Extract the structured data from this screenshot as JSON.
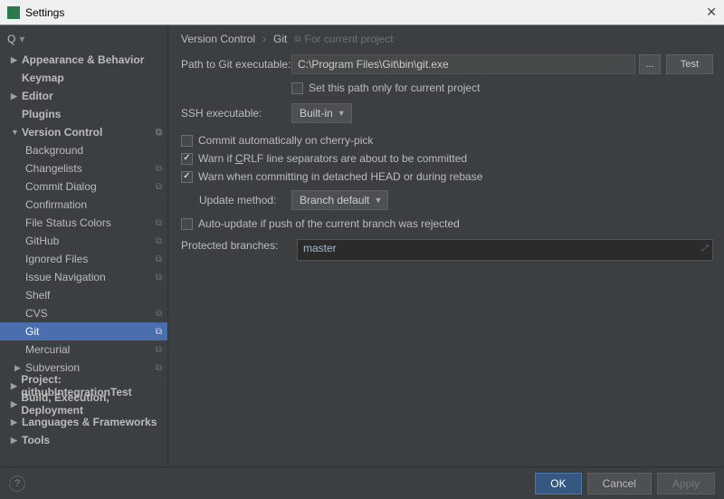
{
  "window": {
    "title": "Settings"
  },
  "search": {
    "placeholder": ""
  },
  "tree": {
    "appearance": "Appearance & Behavior",
    "keymap": "Keymap",
    "editor": "Editor",
    "plugins": "Plugins",
    "versionControl": "Version Control",
    "background": "Background",
    "changelists": "Changelists",
    "commitDialog": "Commit Dialog",
    "confirmation": "Confirmation",
    "fileStatusColors": "File Status Colors",
    "github": "GitHub",
    "ignoredFiles": "Ignored Files",
    "issueNavigation": "Issue Navigation",
    "shelf": "Shelf",
    "cvs": "CVS",
    "git": "Git",
    "mercurial": "Mercurial",
    "subversion": "Subversion",
    "project": "Project: githubIntegrationTest",
    "build": "Build, Execution, Deployment",
    "langs": "Languages & Frameworks",
    "tools": "Tools"
  },
  "breadcrumb": {
    "a": "Version Control",
    "b": "Git",
    "hint": "For current project"
  },
  "form": {
    "pathLabel": "Path to Git executable:",
    "pathValue": "C:\\Program Files\\Git\\bin\\git.exe",
    "dots": "...",
    "test": "Test",
    "setPath": "Set this path only for current project",
    "sshLabel": "SSH executable:",
    "sshValue": "Built-in",
    "autoCommit": "Commit automatically on cherry-pick",
    "warnCrlfPre": "Warn if ",
    "warnCrlfU": "C",
    "warnCrlfPost": "RLF line separators are about to be committed",
    "warnDetached": "Warn when committing in detached HEAD or during rebase",
    "updateLabel": "Update method:",
    "updateValue": "Branch default",
    "autoUpdate": "Auto-update if push of the current branch was rejected",
    "protectedLabel": "Protected branches:",
    "protectedValue": "master"
  },
  "footer": {
    "ok": "OK",
    "cancel": "Cancel",
    "apply": "Apply"
  }
}
